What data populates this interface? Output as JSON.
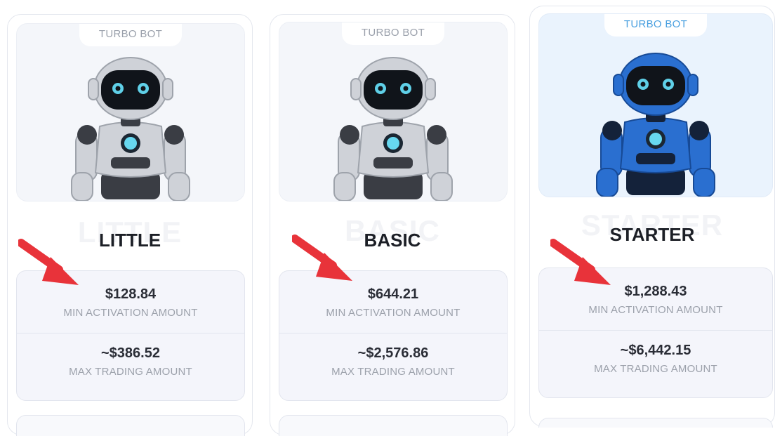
{
  "cards": [
    {
      "tag": "TURBO BOT",
      "title": "LITTLE",
      "min_amount": "$128.84",
      "min_label": "MIN ACTIVATION AMOUNT",
      "max_amount": "~$386.52",
      "max_label": "MAX TRADING AMOUNT"
    },
    {
      "tag": "TURBO BOT",
      "title": "BASIC",
      "min_amount": "$644.21",
      "min_label": "MIN ACTIVATION AMOUNT",
      "max_amount": "~$2,576.86",
      "max_label": "MAX TRADING AMOUNT"
    },
    {
      "tag": "TURBO BOT",
      "title": "STARTER",
      "min_amount": "$1,288.43",
      "min_label": "MIN ACTIVATION AMOUNT",
      "max_amount": "~$6,442.15",
      "max_label": "MAX TRADING AMOUNT"
    }
  ],
  "colors": {
    "arrow": "#e8333a",
    "robot_silver": "#c9ccd2",
    "robot_blue": "#1f5fc0",
    "eye_glow": "#5fd0e8"
  },
  "icons": [
    "robot-silver-image",
    "robot-blue-image",
    "red-arrow-icon"
  ]
}
